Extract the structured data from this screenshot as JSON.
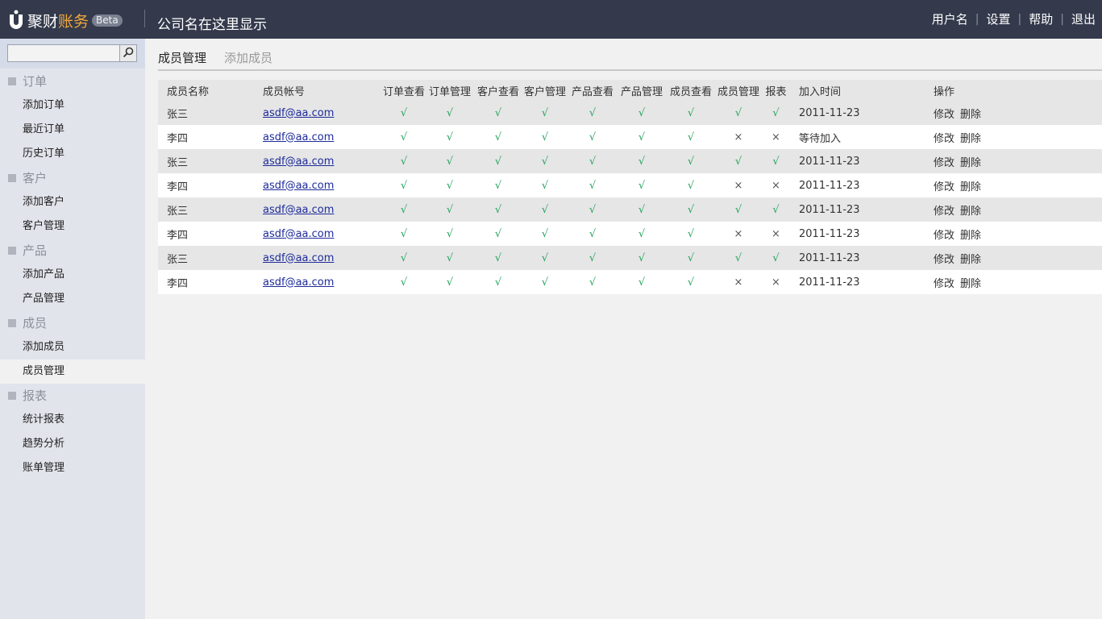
{
  "header": {
    "logo_text_a": "聚财",
    "logo_text_b": "账务",
    "badge": "Beta",
    "company": "公司名在这里显示",
    "nav": [
      "用户名",
      "设置",
      "帮助",
      "退出"
    ]
  },
  "sidebar": {
    "search_placeholder": "",
    "groups": [
      {
        "label": "订单",
        "items": [
          "添加订单",
          "最近订单",
          "历史订单"
        ]
      },
      {
        "label": "客户",
        "items": [
          "添加客户",
          "客户管理"
        ]
      },
      {
        "label": "产品",
        "items": [
          "添加产品",
          "产品管理"
        ]
      },
      {
        "label": "成员",
        "items": [
          "添加成员",
          "成员管理"
        ]
      },
      {
        "label": "报表",
        "items": [
          "统计报表",
          "趋势分析",
          "账单管理"
        ]
      }
    ],
    "active_item": "成员管理"
  },
  "tabs": [
    "成员管理",
    "添加成员"
  ],
  "table": {
    "headers": [
      "成员名称",
      "成员帐号",
      "订单查看",
      "订单管理",
      "客户查看",
      "客户管理",
      "产品查看",
      "产品管理",
      "成员查看",
      "成员管理",
      "报表",
      "加入时间",
      "操作"
    ],
    "actions": [
      "修改",
      "删除"
    ],
    "rows": [
      {
        "name": "张三",
        "account": "asdf@aa.com",
        "perms": [
          "√",
          "√",
          "√",
          "√",
          "√",
          "√",
          "√",
          "√",
          "√"
        ],
        "joined": "2011-11-23"
      },
      {
        "name": "李四",
        "account": "asdf@aa.com",
        "perms": [
          "√",
          "√",
          "√",
          "√",
          "√",
          "√",
          "√",
          "×",
          "×"
        ],
        "joined": "等待加入"
      },
      {
        "name": "张三",
        "account": "asdf@aa.com",
        "perms": [
          "√",
          "√",
          "√",
          "√",
          "√",
          "√",
          "√",
          "√",
          "√"
        ],
        "joined": "2011-11-23"
      },
      {
        "name": "李四",
        "account": "asdf@aa.com",
        "perms": [
          "√",
          "√",
          "√",
          "√",
          "√",
          "√",
          "√",
          "×",
          "×"
        ],
        "joined": "2011-11-23"
      },
      {
        "name": "张三",
        "account": "asdf@aa.com",
        "perms": [
          "√",
          "√",
          "√",
          "√",
          "√",
          "√",
          "√",
          "√",
          "√"
        ],
        "joined": "2011-11-23"
      },
      {
        "name": "李四",
        "account": "asdf@aa.com",
        "perms": [
          "√",
          "√",
          "√",
          "√",
          "√",
          "√",
          "√",
          "×",
          "×"
        ],
        "joined": "2011-11-23"
      },
      {
        "name": "张三",
        "account": "asdf@aa.com",
        "perms": [
          "√",
          "√",
          "√",
          "√",
          "√",
          "√",
          "√",
          "√",
          "√"
        ],
        "joined": "2011-11-23"
      },
      {
        "name": "李四",
        "account": "asdf@aa.com",
        "perms": [
          "√",
          "√",
          "√",
          "√",
          "√",
          "√",
          "√",
          "×",
          "×"
        ],
        "joined": "2011-11-23"
      }
    ]
  },
  "colors": {
    "topbar": "#343a4c",
    "logo_accent": "#f0a73c",
    "check": "#21a35a",
    "link": "#1d2b9a"
  }
}
